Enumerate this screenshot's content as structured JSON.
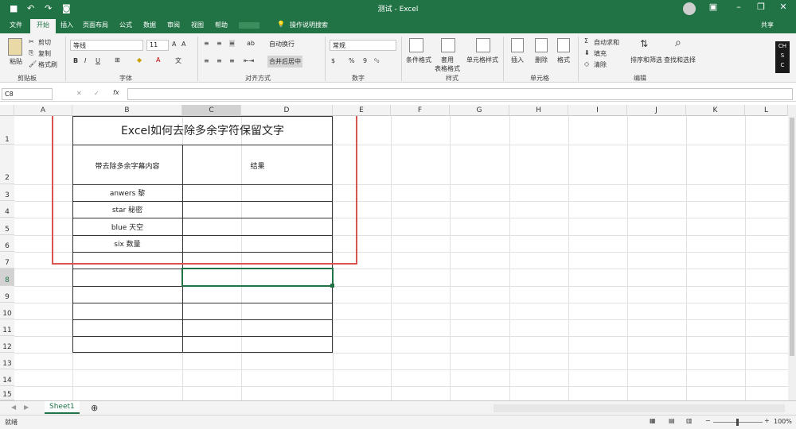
{
  "window": {
    "title": "测试 - Excel",
    "user_share": "共享"
  },
  "tabs": [
    "文件",
    "开始",
    "插入",
    "页面布局",
    "公式",
    "数据",
    "审阅",
    "视图",
    "帮助"
  ],
  "search_label": "操作说明搜索",
  "ribbon": {
    "clipboard": {
      "paste": "粘贴",
      "cut": "剪切",
      "copy": "复制",
      "format_painter": "格式刷",
      "group": "剪贴板"
    },
    "font": {
      "name": "等线",
      "size": "11",
      "bold": "B",
      "italic": "I",
      "underline": "U",
      "group": "字体"
    },
    "align": {
      "wrap": "自动换行",
      "merge": "合并后居中",
      "group": "对齐方式"
    },
    "number": {
      "format": "常规",
      "pct": "%",
      "comma": "9",
      "group": "数字"
    },
    "styles": {
      "cond": "条件格式",
      "table": "套用\n表格格式",
      "cell": "单元格样式",
      "group": "样式"
    },
    "cells": {
      "insert": "插入",
      "delete": "删除",
      "format": "格式",
      "group": "单元格"
    },
    "editing": {
      "autosum": "自动求和",
      "fill": "填充",
      "clear": "清除",
      "sort": "排序和筛选",
      "find": "查找和选择",
      "group": "编辑"
    }
  },
  "formula_bar": {
    "name_box": "C8",
    "fx": "fx",
    "value": ""
  },
  "columns": [
    "A",
    "B",
    "C",
    "D",
    "E",
    "F",
    "G",
    "H",
    "I",
    "J",
    "K",
    "L"
  ],
  "rows": [
    "1",
    "2",
    "3",
    "4",
    "5",
    "6",
    "7",
    "8",
    "9",
    "10",
    "11",
    "12",
    "13",
    "14",
    "15"
  ],
  "sheet": {
    "title": "Excel如何去除多余字符保留文字",
    "header_b": "带去除多余字幕内容",
    "header_c": "结果",
    "items": [
      "anwers 黎",
      "star 秘密",
      "blue 天空",
      "six 数量"
    ]
  },
  "sheet_tab": "Sheet1",
  "status": {
    "ready": "就绪",
    "zoom": "100%"
  },
  "colors": {
    "accent": "#217346",
    "highlight_box": "#d9534f",
    "select": "#217346"
  }
}
